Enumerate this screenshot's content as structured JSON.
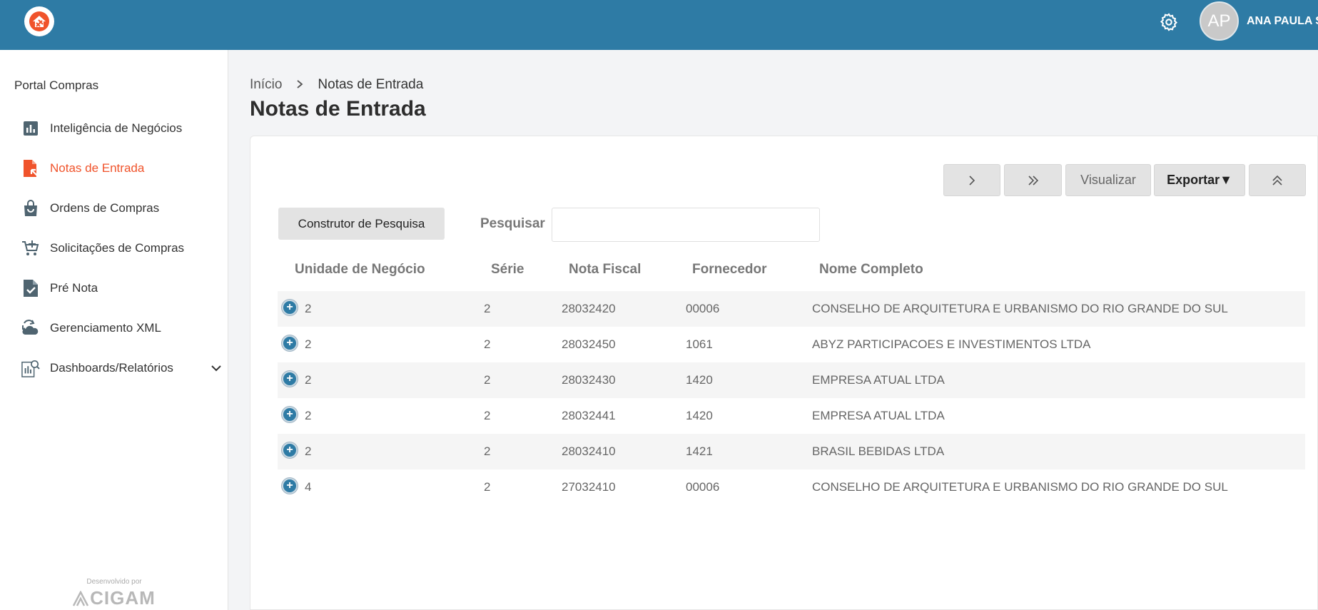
{
  "header": {
    "user_initials": "AP",
    "user_name": "ANA PAULA S"
  },
  "sidebar": {
    "title": "Portal Compras",
    "items": [
      {
        "label": "Inteligência de Negócios",
        "icon": "bar-chart-icon"
      },
      {
        "label": "Notas de Entrada",
        "icon": "invoice-file-icon",
        "active": true
      },
      {
        "label": "Ordens de Compras",
        "icon": "shopping-bag-icon"
      },
      {
        "label": "Solicitações de Compras",
        "icon": "cart-add-icon"
      },
      {
        "label": "Pré Nota",
        "icon": "file-check-icon"
      },
      {
        "label": "Gerenciamento XML",
        "icon": "cloud-transfer-icon"
      },
      {
        "label": "Dashboards/Relatórios",
        "icon": "report-search-icon"
      }
    ],
    "credit_small": "Desenvolvido por",
    "credit_brand": "CIGAM"
  },
  "breadcrumb": {
    "home": "Início",
    "current": "Notas de Entrada"
  },
  "page_title": "Notas de Entrada",
  "toolbar": {
    "visualizar": "Visualizar",
    "exportar": "Exportar▼"
  },
  "search": {
    "builder_label": "Construtor de Pesquisa",
    "label": "Pesquisar",
    "value": "",
    "placeholder": ""
  },
  "table": {
    "headers": [
      "Unidade de Negócio",
      "Série",
      "Nota Fiscal",
      "Fornecedor",
      "Nome Completo"
    ],
    "rows": [
      [
        "2",
        "2",
        "28032420",
        "00006",
        "CONSELHO DE ARQUITETURA E URBANISMO DO RIO GRANDE DO SUL"
      ],
      [
        "2",
        "2",
        "28032450",
        "1061",
        "ABYZ PARTICIPACOES E INVESTIMENTOS LTDA"
      ],
      [
        "2",
        "2",
        "28032430",
        "1420",
        "EMPRESA ATUAL LTDA"
      ],
      [
        "2",
        "2",
        "28032441",
        "1420",
        "EMPRESA ATUAL LTDA"
      ],
      [
        "2",
        "2",
        "28032410",
        "1421",
        "BRASIL BEBIDAS LTDA"
      ],
      [
        "4",
        "2",
        "27032410",
        "00006",
        "CONSELHO DE ARQUITETURA E URBANISMO DO RIO GRANDE DO SUL"
      ]
    ]
  },
  "colors": {
    "header_bg": "#2e7ba5",
    "active_nav": "#f0532b"
  }
}
